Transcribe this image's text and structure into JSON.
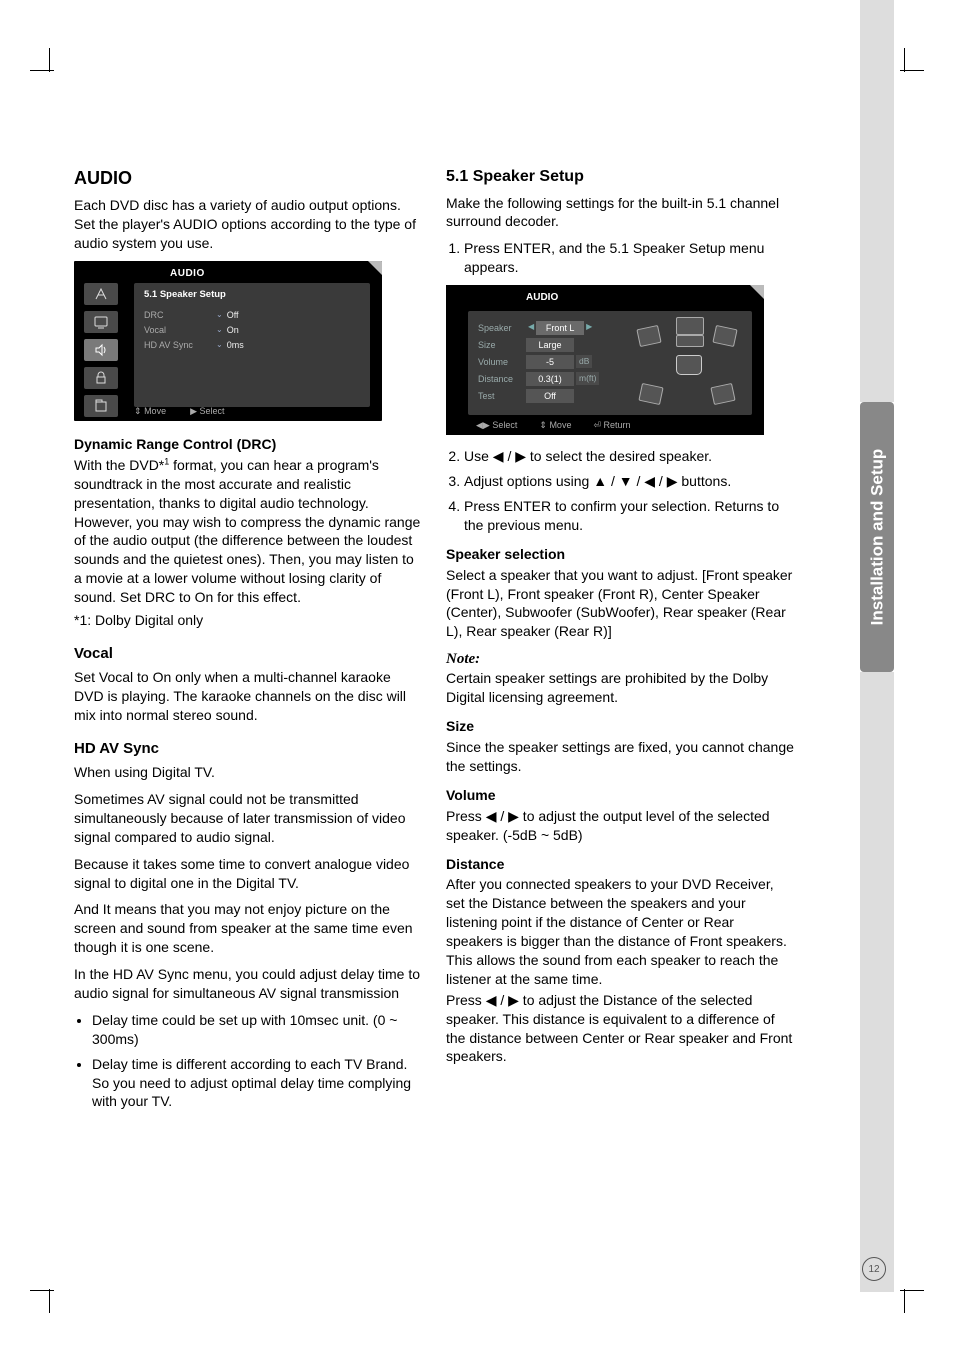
{
  "side_tab": "Installation and Setup",
  "page_number": "12",
  "left": {
    "heading": "AUDIO",
    "intro": "Each DVD disc has a variety of audio output options. Set the player's AUDIO options according to the type of audio system you use.",
    "osd": {
      "title": "AUDIO",
      "menu_highlight": "5.1 Speaker Setup",
      "rows": [
        {
          "k": "DRC",
          "v": "Off"
        },
        {
          "k": "Vocal",
          "v": "On"
        },
        {
          "k": "HD AV Sync",
          "v": "0ms"
        }
      ],
      "foot_move": "Move",
      "foot_select": "Select"
    },
    "drc": {
      "title": "Dynamic Range Control (DRC)",
      "p1a": "With the DVD*",
      "p1sup": "1",
      "p1b": " format, you can hear a program's soundtrack in the most accurate and realistic presentation, thanks to digital audio technology. However, you may wish to compress the dynamic range of the audio output (the difference between the loudest sounds and the quietest ones). Then, you may listen to a movie at a lower volume without losing clarity of sound. Set DRC to On for this effect.",
      "note": "*1: Dolby Digital only"
    },
    "vocal": {
      "title": "Vocal",
      "p": "Set Vocal to On only when a multi-channel karaoke DVD is playing. The karaoke channels on the disc will mix into normal stereo sound."
    },
    "hdav": {
      "title": "HD AV Sync",
      "p1": "When using Digital TV.",
      "p2": "Sometimes AV signal could not be transmitted simultaneously because of later transmission of video signal compared to audio signal.",
      "p3": "Because it takes some time to convert analogue video signal to digital one in the Digital TV.",
      "p4": "And It means that you may not enjoy picture on the screen and sound from speaker at the same time even though it is one scene.",
      "p5": "In the HD AV Sync menu, you could adjust delay time to audio signal for simultaneous AV signal transmission",
      "b1": "Delay time could be set up with 10msec unit. (0 ~ 300ms)",
      "b2": "Delay time is different according to each TV Brand. So you need to adjust optimal delay time complying with your TV."
    }
  },
  "right": {
    "heading": "5.1 Speaker Setup",
    "intro": "Make the following settings for the built-in 5.1 channel surround decoder.",
    "step1": "Press ENTER, and the 5.1 Speaker Setup menu appears.",
    "osd": {
      "title": "AUDIO",
      "rows": {
        "speaker_k": "Speaker",
        "speaker_v": "Front L",
        "size_k": "Size",
        "size_v": "Large",
        "volume_k": "Volume",
        "volume_v": "-5",
        "volume_u": "dB",
        "distance_k": "Distance",
        "distance_v": "0.3(1)",
        "distance_u": "m(ft)",
        "test_k": "Test",
        "test_v": "Off"
      },
      "foot_select": "Select",
      "foot_move": "Move",
      "foot_return": "Return"
    },
    "step2a": "Use ",
    "step2b": " to select the desired speaker.",
    "step3a": "Adjust options using ",
    "step3b": " buttons.",
    "step4": "Press ENTER to confirm your selection. Returns to the previous menu.",
    "spksel": {
      "title": "Speaker selection",
      "p": "Select a speaker that you want to adjust. [Front speaker (Front L), Front speaker (Front R), Center Speaker (Center), Subwoofer (SubWoofer), Rear speaker (Rear L), Rear speaker (Rear R)]"
    },
    "note_label": "Note:",
    "note_p": "Certain speaker settings are prohibited by the Dolby Digital licensing agreement.",
    "size": {
      "title": "Size",
      "p": "Since the speaker settings are fixed, you cannot change the settings."
    },
    "volume": {
      "title": "Volume",
      "p_a": "Press ",
      "p_b": " to adjust the output level of the selected speaker. (-5dB ~ 5dB)"
    },
    "distance": {
      "title": "Distance",
      "p1": "After you connected speakers to your DVD Receiver, set the Distance between the speakers and your listening point if the distance of Center or Rear speakers is bigger than the distance of Front speakers. This allows the sound from each speaker to reach the listener at the same time.",
      "p2a": "Press ",
      "p2b": " to adjust the Distance of the selected speaker. This distance is equivalent to a difference of the distance between Center or Rear speaker and Front speakers."
    }
  },
  "glyphs": {
    "left": "◀",
    "right": "▶",
    "up": "▲",
    "down": "▼",
    "updown": "⇕",
    "leftright": "◀▶",
    "return": "⏎",
    "slash": " / "
  }
}
